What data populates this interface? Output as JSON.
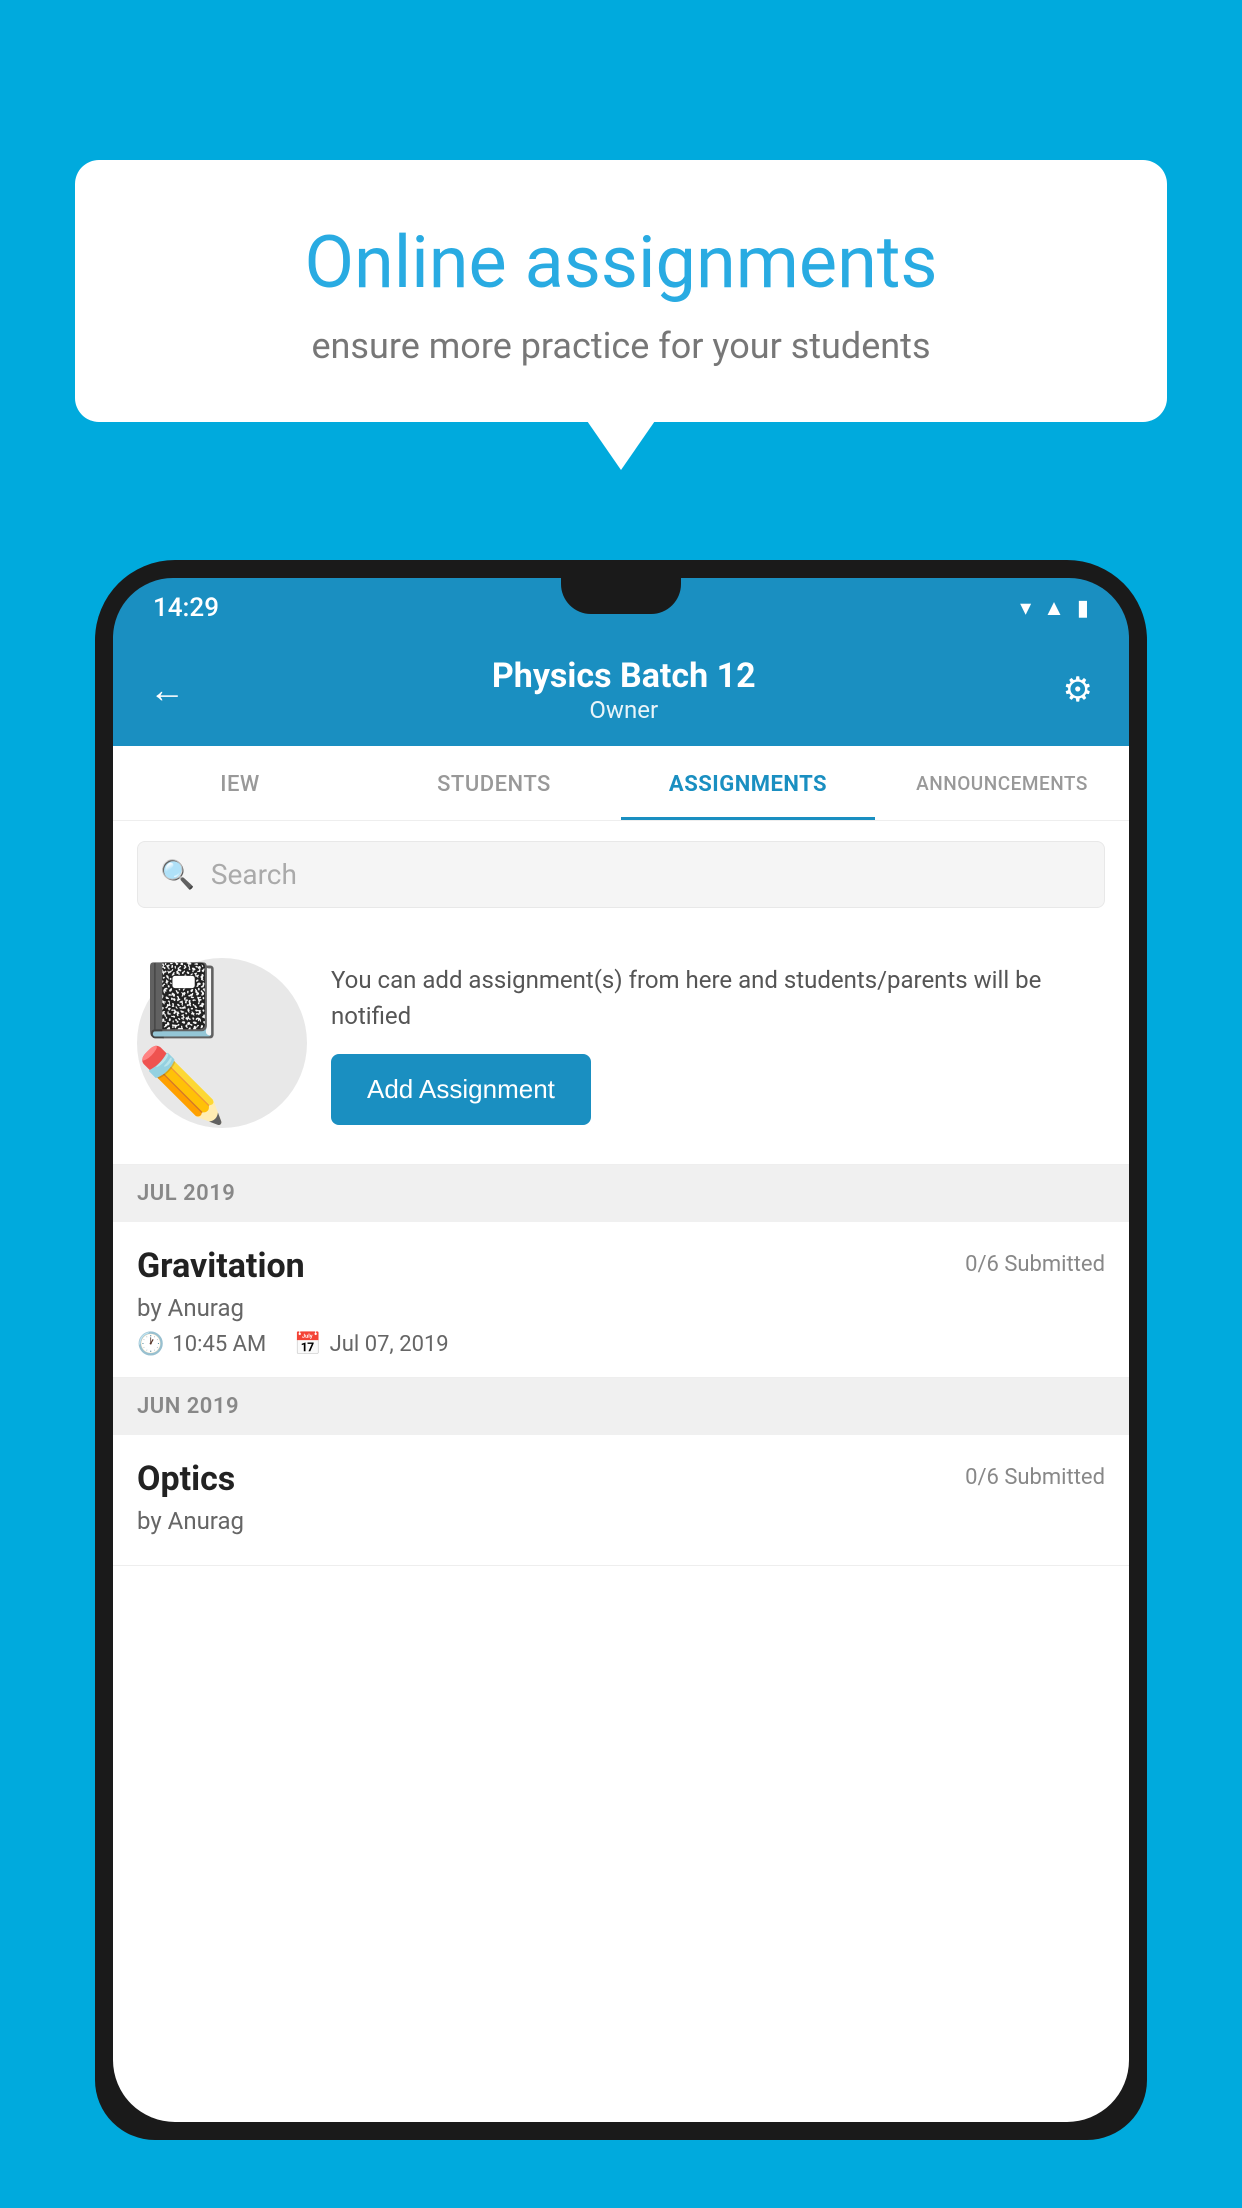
{
  "background": {
    "color": "#00AADD"
  },
  "speech_bubble": {
    "title": "Online assignments",
    "subtitle": "ensure more practice for your students"
  },
  "phone": {
    "status_bar": {
      "time": "14:29",
      "icons": [
        "wifi",
        "signal",
        "battery"
      ]
    },
    "header": {
      "title": "Physics Batch 12",
      "subtitle": "Owner",
      "back_label": "←",
      "settings_label": "⚙"
    },
    "tabs": [
      {
        "label": "IEW",
        "active": false
      },
      {
        "label": "STUDENTS",
        "active": false
      },
      {
        "label": "ASSIGNMENTS",
        "active": true
      },
      {
        "label": "ANNOUNCEMENTS",
        "active": false
      }
    ],
    "search": {
      "placeholder": "Search"
    },
    "promo": {
      "text": "You can add assignment(s) from here and students/parents will be notified",
      "button_label": "Add Assignment"
    },
    "sections": [
      {
        "month_label": "JUL 2019",
        "assignments": [
          {
            "name": "Gravitation",
            "submitted": "0/6 Submitted",
            "by": "by Anurag",
            "time": "10:45 AM",
            "date": "Jul 07, 2019"
          }
        ]
      },
      {
        "month_label": "JUN 2019",
        "assignments": [
          {
            "name": "Optics",
            "submitted": "0/6 Submitted",
            "by": "by Anurag",
            "time": "",
            "date": ""
          }
        ]
      }
    ]
  }
}
